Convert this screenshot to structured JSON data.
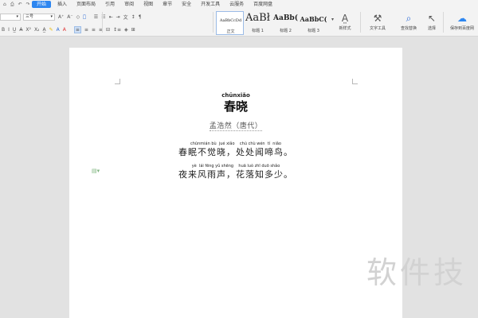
{
  "tabs": [
    "开始",
    "插入",
    "页面布局",
    "引用",
    "审阅",
    "视图",
    "章节",
    "安全",
    "开发工具",
    "云服务",
    "百度网盘"
  ],
  "active_tab": "开始",
  "quick_icons": [
    "⌂",
    "⎙",
    "↶",
    "↷"
  ],
  "ribbon": {
    "font_name": "",
    "font_size": "三号",
    "styles": [
      {
        "preview": "AaBbCcDd",
        "name": "正文"
      },
      {
        "preview": "AaBł",
        "name": "标题 1"
      },
      {
        "preview": "AaBb(",
        "name": "标题 2"
      },
      {
        "preview": "AaBbC(",
        "name": "标题 3"
      }
    ],
    "new_style": "新样式",
    "text_tool": "文字工具",
    "find_replace": "查找替换",
    "select": "选择",
    "save_baidu": "保存到百度网"
  },
  "document": {
    "title_pinyin": "chūnxiǎo",
    "title": "春晓",
    "author": "孟浩然（唐代）",
    "lines": [
      {
        "pinyin": "chūnmián bù  jué xiǎo    chù chù wén  tí  niǎo",
        "text": "春眠不觉晓，处处闻啼鸟。"
      },
      {
        "pinyin": "yè  lái fēng yǔ shēng    huā luò zhī duō shǎo",
        "text": "夜来风雨声，花落知多少。"
      }
    ]
  },
  "watermark": "软件技"
}
